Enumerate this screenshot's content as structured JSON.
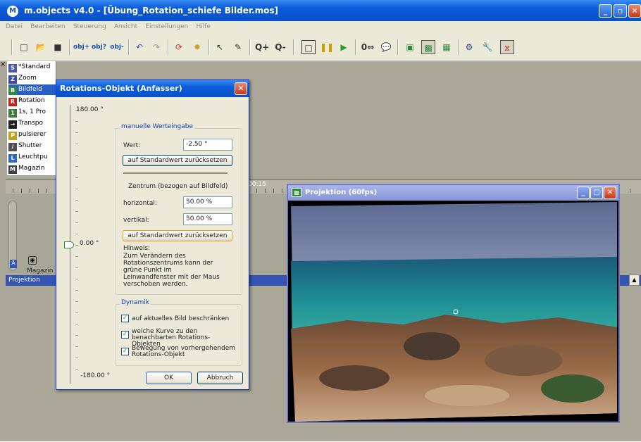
{
  "app": {
    "title": "m.objects v4.0 - [Übung_Rotation_schiefe Bilder.mos]",
    "icon_letter": "M",
    "window_controls": [
      "_",
      "▫",
      "✕"
    ]
  },
  "menu": [
    "Datei",
    "Bearbeiten",
    "Steuerung",
    "Ansicht",
    "Einstellungen",
    "Hilfe"
  ],
  "toolbar": {
    "obj_plus": "obj+",
    "obj_q": "obj?",
    "obj_minus": "obj-",
    "zoom_in": "Q+",
    "zoom_out": "Q-",
    "counter": "0⇔"
  },
  "object_list": {
    "close": "×",
    "items": [
      {
        "label": "*Standard",
        "icon": "S",
        "color": "#4a5aa8"
      },
      {
        "label": "Zoom",
        "icon": "Z",
        "color": "#3d4aa0"
      },
      {
        "label": "Bildfeld",
        "icon": "B",
        "color": "#2a8a3a",
        "selected": true
      },
      {
        "label": "Rotation",
        "icon": "R",
        "color": "#c02020"
      },
      {
        "label": "1s, 1 Pro",
        "icon": "1",
        "color": "#3a7a3a"
      },
      {
        "label": "Transpo",
        "icon": "→",
        "color": "#202020"
      },
      {
        "label": "pulsierer",
        "icon": "P",
        "color": "#c0a020"
      },
      {
        "label": "Shutter",
        "icon": "/",
        "color": "#505050"
      },
      {
        "label": "Leuchtpu",
        "icon": "L",
        "color": "#2a6ac0"
      },
      {
        "label": "Magazin",
        "icon": "M",
        "color": "#404040"
      }
    ]
  },
  "timeline": {
    "label": "00:15",
    "track_label": "Projektion",
    "magazin_label": "Magazin"
  },
  "dialog": {
    "title": "Rotations-Objekt (Anfasser)",
    "close": "✕",
    "slider": {
      "max_label": "180.00 °",
      "mid_label": "0.00 °",
      "min_label": "-180.00 °"
    },
    "manual": {
      "group_title": "manuelle Werteingabe",
      "wert_label": "Wert:",
      "wert_value": "-2.50 °",
      "reset1": "auf Standardwert zurücksetzen",
      "center_title": "Zentrum (bezogen auf Bildfeld)",
      "horizontal_label": "horizontal:",
      "horizontal_value": "50.00 %",
      "vertikal_label": "vertikal:",
      "vertikal_value": "50.00 %",
      "reset2": "auf Standardwert zurücksetzen",
      "hint_title": "Hinweis:",
      "hint_text": "Zum Verändern des Rotationszentrums kann der grüne Punkt im Leinwandfenster mit der Maus verschoben werden."
    },
    "dynamik": {
      "group_title": "Dynamik",
      "opt1": "auf aktuelles Bild beschränken",
      "opt2": "weiche Kurve zu den benachbarten Rotations-Objekten",
      "opt3": "Bewegung von vorhergehendem Rotations-Objekt",
      "check": "✓"
    },
    "ok": "OK",
    "cancel": "Abbruch"
  },
  "projection": {
    "title": "Projektion (60fps)",
    "controls": [
      "_",
      "□",
      "✕"
    ],
    "colors": {
      "sky_top": "#6a7aa5",
      "sea": "#1c8a8a",
      "rocks": "#7a4f35"
    }
  }
}
